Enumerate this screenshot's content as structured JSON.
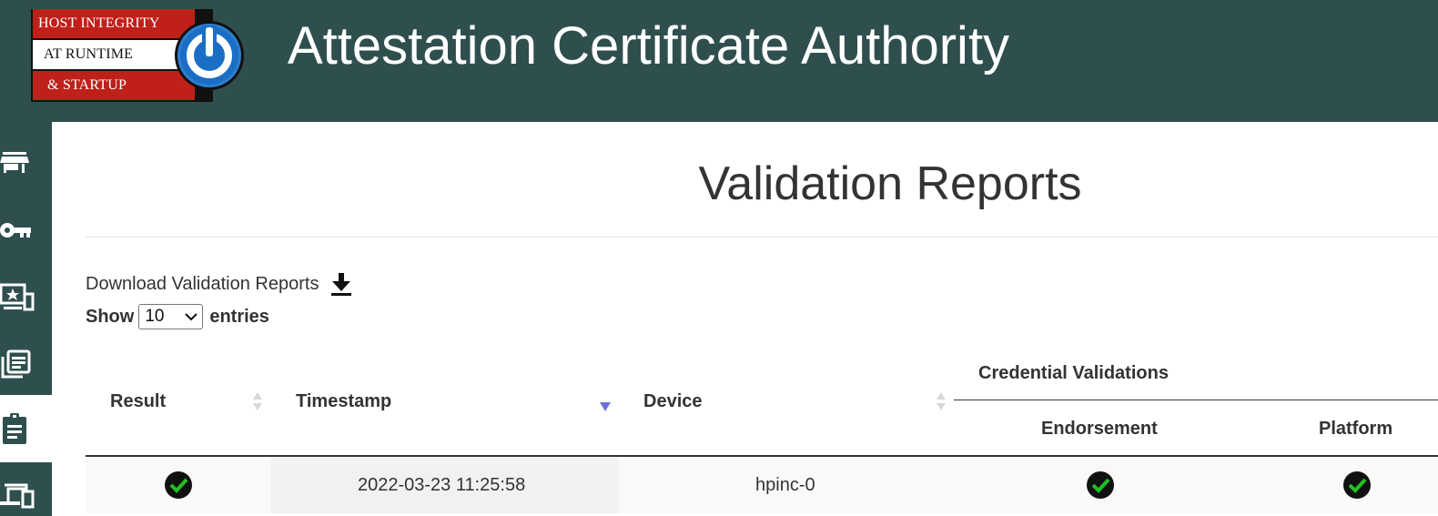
{
  "header": {
    "logo_lines": [
      "HOST INTEGRITY",
      "AT RUNTIME",
      "& STARTUP"
    ],
    "app_title": "Attestation Certificate Authority"
  },
  "sidebar": {
    "items": [
      {
        "icon": "store-icon"
      },
      {
        "icon": "key-icon"
      },
      {
        "icon": "trusted-device-icon"
      },
      {
        "icon": "library-books-icon"
      },
      {
        "icon": "clipboard-icon",
        "active": true
      },
      {
        "icon": "devices-icon"
      }
    ]
  },
  "page": {
    "title": "Validation Reports",
    "download_label": "Download Validation Reports",
    "show_label": "Show",
    "entries_value": "10",
    "entries_label": "entries"
  },
  "table": {
    "group_header": "Credential Validations",
    "columns": {
      "result": "Result",
      "timestamp": "Timestamp",
      "device": "Device",
      "endorsement": "Endorsement",
      "platform": "Platform"
    },
    "sorted_column": "timestamp",
    "sort_direction": "descending",
    "rows": [
      {
        "result": "pass",
        "timestamp": "2022-03-23 11:25:58",
        "device": "hpinc-0",
        "endorsement": "pass",
        "platform": "pass"
      }
    ]
  },
  "colors": {
    "header_bg": "#2f4f4f",
    "logo_red": "#c0201a",
    "sort_active": "#6a72d8",
    "check_green": "#22c022"
  }
}
